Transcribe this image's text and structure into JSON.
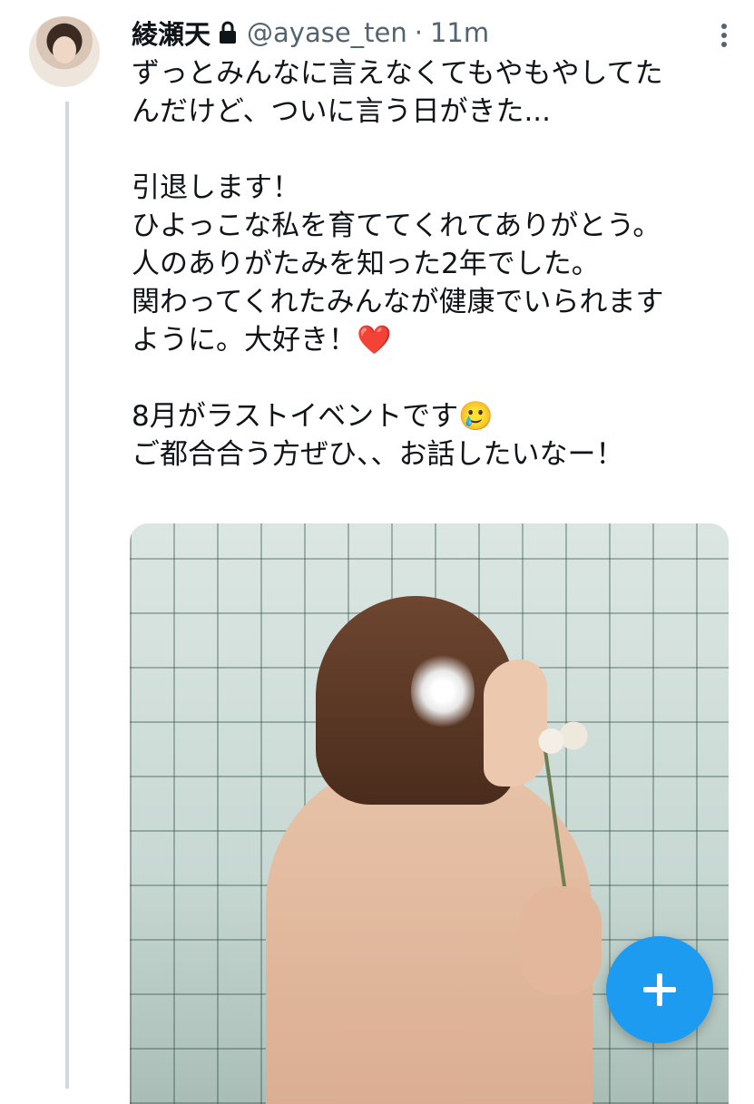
{
  "tweet": {
    "author_name": "綾瀬天",
    "handle": "@ayase_ten",
    "separator": "·",
    "time": "11m",
    "lines": [
      "ずっとみんなに言えなくてもやもやしてた",
      "んだけど、ついに言う日がきた...",
      "",
      "引退します！",
      "ひよっこな私を育ててくれてありがとう。",
      "人のありがたみを知った2年でした。",
      "関わってくれたみんなが健康でいられます",
      "ように。大好き！❤️",
      "",
      "8月がラストイベントです🥲",
      "ご都合合う方ぜひ、、お話したいなー！"
    ]
  },
  "icons": {
    "lock": "lock-icon",
    "more": "more-vertical-icon",
    "compose": "plus-icon"
  },
  "colors": {
    "accent": "#1d9bf0",
    "secondary_text": "#536471",
    "thread_line": "#cfd9de"
  }
}
